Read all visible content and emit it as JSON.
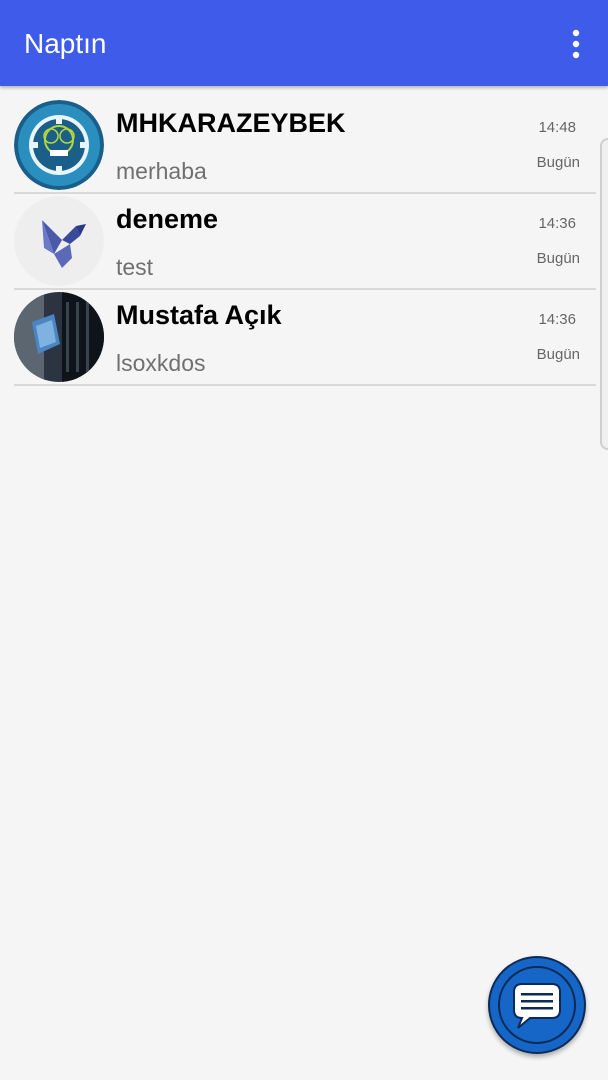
{
  "app_bar": {
    "title": "Naptın",
    "menu_icon": "more-vert-icon",
    "color": "#3f5be9"
  },
  "chats": [
    {
      "name": "MHKARAZEYBEK",
      "preview": "merhaba",
      "time": "14:48",
      "day": "Bugün",
      "avatar": "university-logo-avatar"
    },
    {
      "name": "deneme",
      "preview": "test",
      "time": "14:36",
      "day": "Bugün",
      "avatar": "dove-avatar"
    },
    {
      "name": "Mustafa Açık",
      "preview": "lsoxkdos",
      "time": "14:36",
      "day": "Bugün",
      "avatar": "photo-avatar"
    }
  ],
  "fab": {
    "icon": "chat-bubble-icon",
    "color": "#1566c6"
  }
}
